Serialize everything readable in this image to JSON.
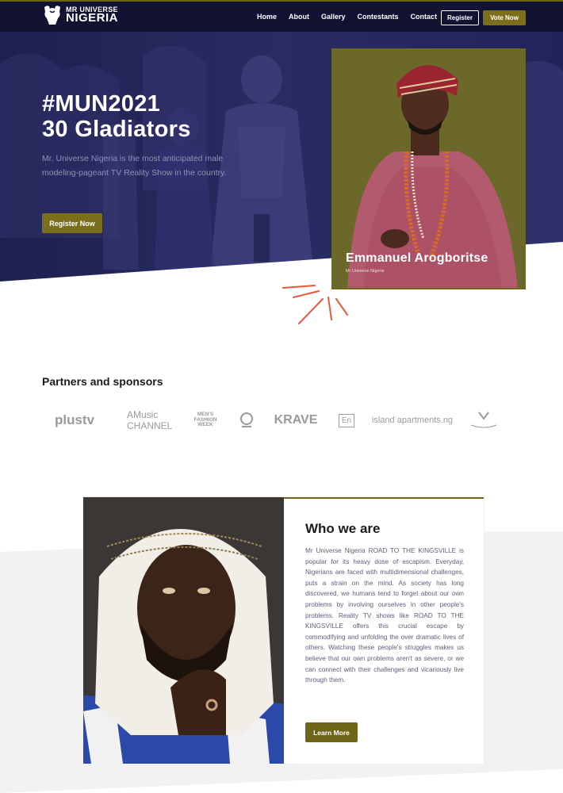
{
  "nav": {
    "logo": {
      "line1": "MR UNIVERSE",
      "line2": "NIGERIA"
    },
    "items": [
      "Home",
      "About",
      "Gallery",
      "Contestants",
      "Contact"
    ],
    "register_label": "Register",
    "vote_label": "Vote Now"
  },
  "hero": {
    "title_line1": "#MUN2021",
    "title_line2": "30 Gladiators",
    "description": "Mr. Universe Nigeria is the most anticipated male modeling-pageant TV Reality Show in the country.",
    "register_label": "Register Now"
  },
  "featured": {
    "name": "Emmanuel Arogboritse",
    "subtitle": "Mr Universe Nigeria"
  },
  "partners": {
    "title": "Partners and sponsors",
    "logos": [
      "plustv",
      "AMusic CHANNEL",
      "MEN'S FASHION WEEK",
      "KRAVE",
      "En",
      "island apartments.ng"
    ]
  },
  "about": {
    "title": "Who we are",
    "body": "Mr Universe Nigeria ROAD TO THE KINGSVILLE is popular for its heavy dose of escapism. Everyday, Nigerians are faced with multidimensional challenges, puts a strain on the mind. As society has long discovered, we humans tend to forget about our own problems by involving ourselves in other people's problems. Reality TV shows like ROAD TO THE KINGSVILLE offers this crucial escape by commodifying and unfolding the over dramatic lives of others. Watching these people's struggles makes us believe that our own problems aren't as severe, or we can connect with their challenges and vicariously live through them.",
    "button_label": "Learn More"
  },
  "colors": {
    "nav_bg": "#121232",
    "hero_bg": "#26275a",
    "accent_gold": "#7b6f1e",
    "featured_bg": "#6d6a2a",
    "burst": "#e8573a"
  },
  "icons": [
    "logo-muscle-icon",
    "burst-icon"
  ]
}
